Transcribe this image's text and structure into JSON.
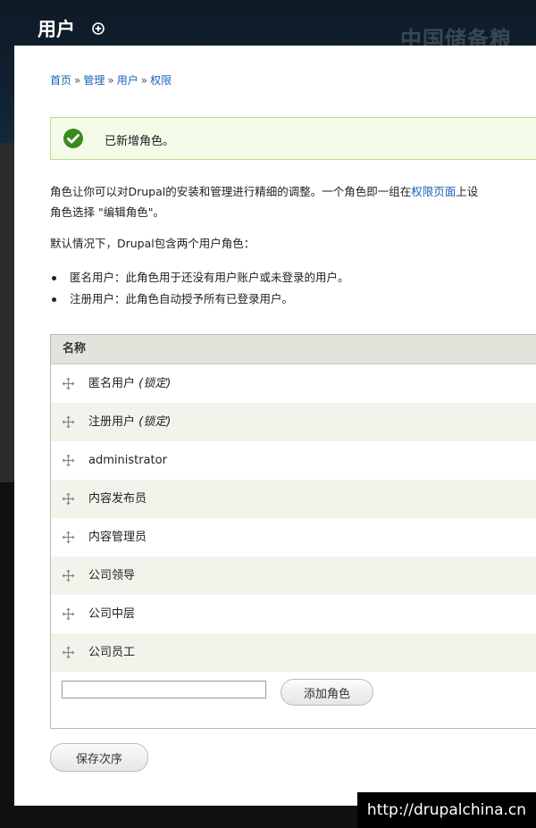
{
  "header": {
    "title": "用户",
    "add_icon": "plus-circle-icon",
    "site_name": "中国储备粮"
  },
  "breadcrumb": {
    "items": [
      "首页",
      "管理",
      "用户",
      "权限"
    ],
    "separator": "»"
  },
  "message": {
    "icon": "check-circle-icon",
    "text": "已新增角色。",
    "color": "#3b8a1e"
  },
  "intro": {
    "line1_before": "角色让你可以对Drupal的安装和管理进行精细的调整。一个角色即一组在",
    "link": "权限页面",
    "line1_after": "上设",
    "line2": "角色选择 \"编辑角色\"。"
  },
  "default_text": "默认情况下，Drupal包含两个用户角色：",
  "default_roles": [
    "匿名用户：此角色用于还没有用户账户或未登录的用户。",
    "注册用户：此角色自动授予所有已登录用户。"
  ],
  "table": {
    "header": "名称",
    "rows": [
      {
        "name": "匿名用户",
        "note": "(锁定)"
      },
      {
        "name": "注册用户",
        "note": "(锁定)"
      },
      {
        "name": "administrator",
        "note": ""
      },
      {
        "name": "内容发布员",
        "note": ""
      },
      {
        "name": "内容管理员",
        "note": ""
      },
      {
        "name": "公司领导",
        "note": ""
      },
      {
        "name": "公司中层",
        "note": ""
      },
      {
        "name": "公司员工",
        "note": ""
      }
    ],
    "new_role_value": "",
    "add_button": "添加角色"
  },
  "save_button": "保存次序",
  "watermark": "http://drupalchina.cn",
  "colors": {
    "link": "#1b62b5",
    "message_bg": "#f3fbe8",
    "table_header_bg": "#e3e3dc"
  }
}
